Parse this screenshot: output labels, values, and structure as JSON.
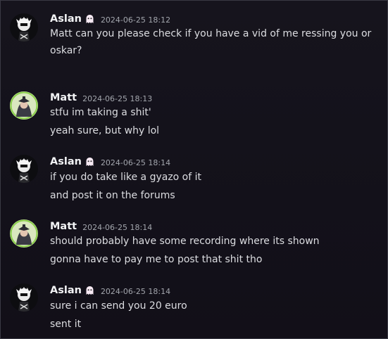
{
  "messages": [
    {
      "author": "Aslan",
      "timestamp": "2024-06-25 18:12",
      "badge_icon": "ghost-icon",
      "lines": [
        "Matt can you please check if you have a vid of me ressing you or",
        "oskar?"
      ]
    },
    {
      "author": "Matt",
      "timestamp": "2024-06-25 18:13",
      "lines": [
        "stfu im taking a shit'",
        "yeah sure, but why lol"
      ]
    },
    {
      "author": "Aslan",
      "timestamp": "2024-06-25 18:14",
      "badge_icon": "ghost-icon",
      "lines": [
        "if you do take like a gyazo of it",
        "and post it on the forums"
      ]
    },
    {
      "author": "Matt",
      "timestamp": "2024-06-25 18:14",
      "lines": [
        "should probably have some recording where its shown",
        "gonna have to pay me to post that shit tho"
      ]
    },
    {
      "author": "Aslan",
      "timestamp": "2024-06-25 18:14",
      "badge_icon": "ghost-icon",
      "lines": [
        "sure i can send you 20 euro",
        "sent it"
      ]
    }
  ],
  "colors": {
    "background": "#13111a",
    "author_name": "#f2f3f5",
    "timestamp": "#a3a6ad",
    "message_text": "#dcdde1",
    "matt_avatar_ring": "#8ad04a"
  }
}
